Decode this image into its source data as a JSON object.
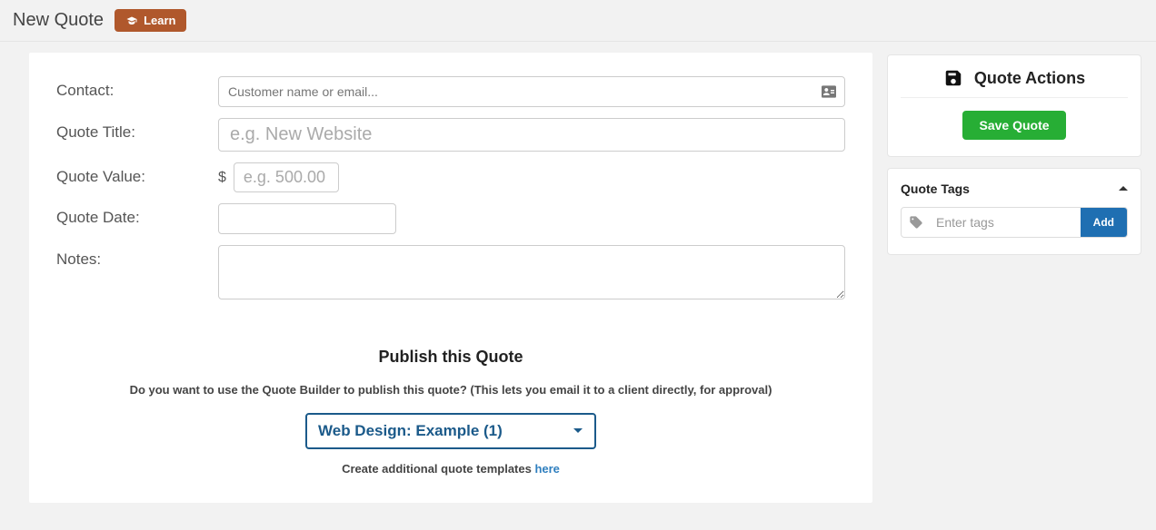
{
  "header": {
    "title": "New Quote",
    "learn_label": "Learn"
  },
  "form": {
    "contact": {
      "label": "Contact:",
      "placeholder": "Customer name or email...",
      "value": ""
    },
    "title": {
      "label": "Quote Title:",
      "placeholder": "e.g. New Website",
      "value": ""
    },
    "value": {
      "label": "Quote Value:",
      "currency": "$",
      "placeholder": "e.g. 500.00",
      "value": ""
    },
    "date": {
      "label": "Quote Date:",
      "value": ""
    },
    "notes": {
      "label": "Notes:",
      "value": ""
    }
  },
  "publish": {
    "heading": "Publish this Quote",
    "description": "Do you want to use the Quote Builder to publish this quote? (This lets you email it to a client directly, for approval)",
    "selected_template": "Web Design: Example (1)",
    "create_prefix": "Create additional quote templates ",
    "create_link": "here"
  },
  "sidebar": {
    "actions": {
      "title": "Quote Actions",
      "save_label": "Save Quote"
    },
    "tags": {
      "title": "Quote Tags",
      "placeholder": "Enter tags",
      "add_label": "Add"
    }
  }
}
